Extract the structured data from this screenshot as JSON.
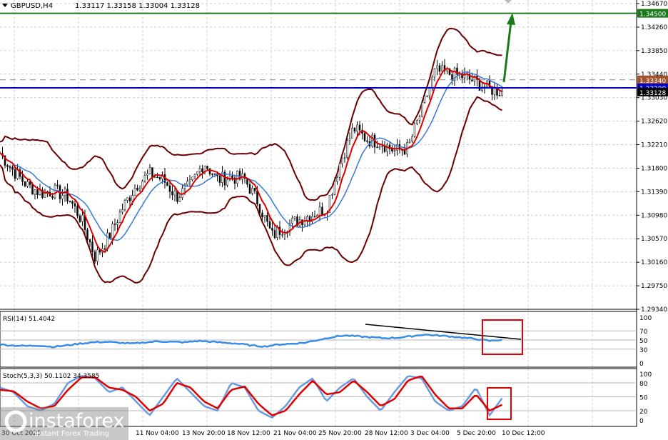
{
  "header": {
    "symbol": "GBPUSD,H4",
    "ohlc": "1.33117 1.33158 1.33004 1.33128"
  },
  "price_axis": [
    "1.34670",
    "1.34260",
    "1.33850",
    "1.33440",
    "1.33030",
    "1.32620",
    "1.32210",
    "1.31800",
    "1.31390",
    "1.30980",
    "1.30570",
    "1.30160",
    "1.29750",
    "1.29340"
  ],
  "price_markers": {
    "green": "1.34500",
    "brown": "1.33340",
    "blue": "1.33200",
    "current": "1.33128"
  },
  "time_axis": [
    "30 Oct 2025",
    "11 Nov 04:00",
    "13 Nov 20:00",
    "18 Nov 12:00",
    "21 Nov 04:00",
    "25 Nov 20:00",
    "28 Nov 12:00",
    "3 Dec 04:00",
    "5 Dec 20:00",
    "10 Dec 12:00"
  ],
  "rsi": {
    "label": "RSI(14) 51.4042",
    "levels": [
      "100",
      "70",
      "50",
      "30",
      "0"
    ]
  },
  "stoch": {
    "label": "Stoch(5,3,3) 50.1102 34.3585",
    "levels": [
      "100",
      "80",
      "50",
      "20",
      "0"
    ]
  },
  "watermark": {
    "brand": "instaforex",
    "tagline": "Instant Forex Trading"
  },
  "colors": {
    "green": "#1a7a1a",
    "blue": "#0000cc",
    "brown": "#a0522d",
    "bands": "#6b0000",
    "ma_red": "#dd0000",
    "ma_blue": "#3a78d8",
    "rsi": "#3a8ee6",
    "stoch_main": "#6a9ae0",
    "stoch_signal": "#e00000",
    "box": "#e00000"
  },
  "chart_data": {
    "type": "candlestick",
    "close_keypoints": [
      1.3206,
      1.3175,
      1.315,
      1.3137,
      1.314,
      1.313,
      1.309,
      1.3025,
      1.306,
      1.311,
      1.315,
      1.317,
      1.316,
      1.313,
      1.315,
      1.319,
      1.316,
      1.3165,
      1.316,
      1.312,
      1.3062,
      1.308,
      1.309,
      1.31,
      1.311,
      1.319,
      1.325,
      1.323,
      1.3225,
      1.321,
      1.3215,
      1.328,
      1.3349,
      1.3345,
      1.334,
      1.333,
      1.3318,
      1.3313
    ],
    "ylim": [
      1.2934,
      1.3467
    ],
    "hlines": [
      1.345,
      1.3334,
      1.332
    ],
    "rsi_keypoints": [
      40,
      38,
      37,
      38,
      35,
      38,
      42,
      45,
      46,
      44,
      42,
      45,
      47,
      46,
      45,
      48,
      46,
      44,
      42,
      38,
      36,
      40,
      42,
      44,
      50,
      56,
      60,
      58,
      56,
      54,
      55,
      58,
      62,
      60,
      58,
      55,
      52,
      48,
      51
    ],
    "stoch_main_keypoints": [
      70,
      60,
      30,
      20,
      35,
      80,
      95,
      90,
      60,
      70,
      40,
      10,
      50,
      90,
      60,
      30,
      20,
      80,
      70,
      20,
      5,
      30,
      70,
      90,
      40,
      70,
      90,
      50,
      20,
      60,
      95,
      90,
      40,
      20,
      30,
      70,
      10,
      50
    ],
    "stoch_signal_keypoints": [
      65,
      62,
      40,
      25,
      30,
      65,
      92,
      92,
      70,
      65,
      50,
      20,
      35,
      80,
      70,
      40,
      25,
      65,
      72,
      35,
      10,
      20,
      55,
      85,
      55,
      60,
      85,
      60,
      30,
      45,
      85,
      95,
      55,
      25,
      25,
      55,
      20,
      34
    ]
  }
}
